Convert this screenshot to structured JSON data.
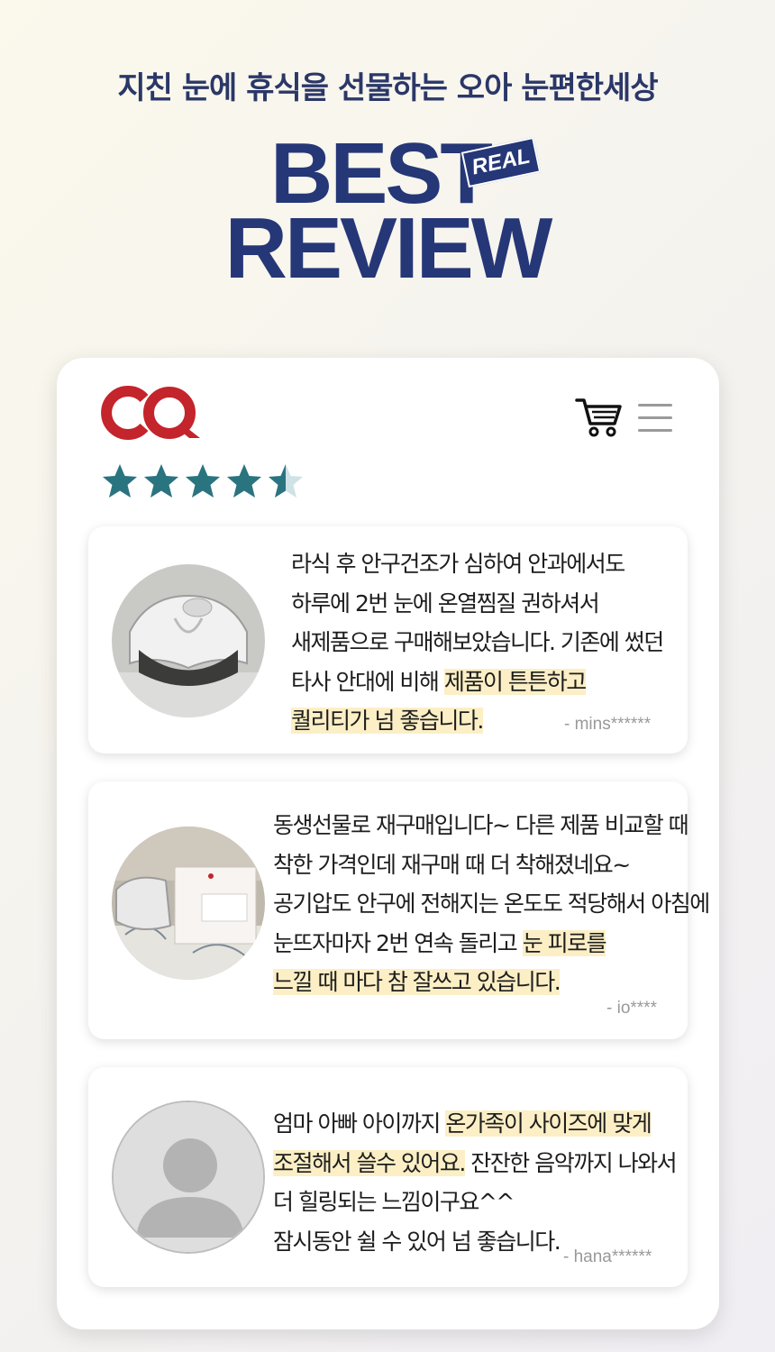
{
  "header": {
    "subtitle": "지친 눈에 휴식을 선물하는 오아 눈편한세상",
    "best": "BEST",
    "badge": "REAL",
    "review": "REVIEW"
  },
  "app": {
    "logo_icon": "oa-logo",
    "cart_icon": "cart-icon",
    "menu_icon": "hamburger-menu-icon",
    "rating": 4.5,
    "colors": {
      "brand": "#c4242b",
      "star": "#2a7480",
      "title": "#253777",
      "highlight": "#fcefc6"
    }
  },
  "reviews": [
    {
      "lines": [
        [
          {
            "t": "라식 후 안구건조가 심하여 안과에서도"
          }
        ],
        [
          {
            "t": "하루에 2번 눈에 온열찜질 권하셔서"
          }
        ],
        [
          {
            "t": "새제품으로 구매해보았습니다. 기존에 썼던"
          }
        ],
        [
          {
            "t": "타사 안대에 비해 "
          },
          {
            "t": "제품이 튼튼하고",
            "hl": true
          }
        ],
        [
          {
            "t": "퀄리티가 넘 좋습니다.",
            "hl": true
          }
        ]
      ],
      "author": "- mins******"
    },
    {
      "lines": [
        [
          {
            "t": "동생선물로 재구매입니다~ 다른 제품 비교할 때"
          }
        ],
        [
          {
            "t": "착한 가격인데 재구매 때 더 착해졌네요~"
          }
        ],
        [
          {
            "t": "공기압도 안구에 전해지는 온도도 적당해서 아침에"
          }
        ],
        [
          {
            "t": "눈뜨자마자 2번 연속 돌리고 "
          },
          {
            "t": "눈 피로를",
            "hl": true
          }
        ],
        [
          {
            "t": "느낄 때 마다 참 잘쓰고 있습니다.",
            "hl": true
          }
        ]
      ],
      "author": "- io****"
    },
    {
      "lines": [
        [
          {
            "t": "엄마 아빠 아이까지 "
          },
          {
            "t": "온가족이 사이즈에 맞게",
            "hl": true
          }
        ],
        [
          {
            "t": "조절해서 쓸수 있어요.",
            "hl": true
          },
          {
            "t": "  잔잔한 음악까지 나와서"
          }
        ],
        [
          {
            "t": "더 힐링되는 느낌이구요^^"
          }
        ],
        [
          {
            "t": "잠시동안 쉴 수 있어 넘 좋습니다."
          }
        ]
      ],
      "author": "- hana******"
    }
  ]
}
